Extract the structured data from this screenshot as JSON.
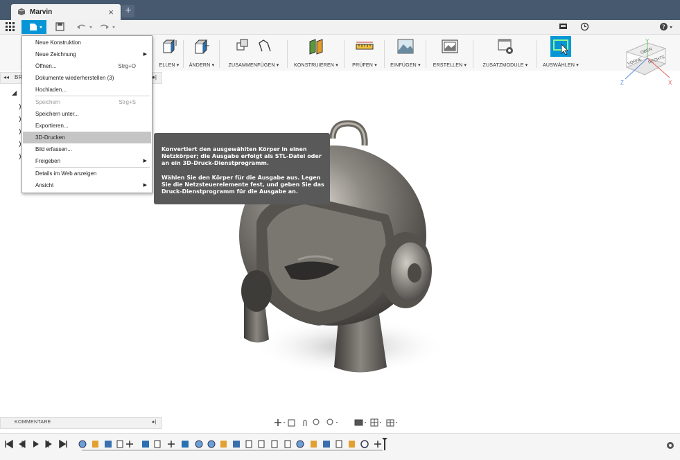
{
  "window": {
    "tab_title": "Marvin",
    "tab_close": "×",
    "new_tab": "+"
  },
  "ribbon": {
    "groups": [
      {
        "label": "ELLEN ▾"
      },
      {
        "label": "ÄNDERN ▾"
      },
      {
        "label": "ZUSAMMENFÜGEN ▾"
      },
      {
        "label": "KONSTRUIEREN ▾"
      },
      {
        "label": "PRÜFEN ▾"
      },
      {
        "label": "EINFÜGEN ▾"
      },
      {
        "label": "ERSTELLEN ▾"
      },
      {
        "label": "ZUSATZMODULE ▾"
      },
      {
        "label": "AUSWÄHLEN ▾"
      }
    ]
  },
  "browser": {
    "header": "BR"
  },
  "viewcube": {
    "top": "OBEN",
    "front": "VORNE",
    "right": "RECHTS",
    "axis_x": "X",
    "axis_y": "Y",
    "axis_z": "Z"
  },
  "file_menu": {
    "items": [
      {
        "label": "Neue Konstruktion",
        "shortcut": "",
        "submenu": false
      },
      {
        "label": "Neue Zeichnung",
        "shortcut": "",
        "submenu": true
      },
      {
        "label": "Öffnen...",
        "shortcut": "Strg+O",
        "submenu": false
      },
      {
        "label": "Dokumente wiederherstellen (3)",
        "shortcut": "",
        "submenu": false
      },
      {
        "label": "Hochladen...",
        "shortcut": "",
        "submenu": false
      },
      {
        "label": "Speichern",
        "shortcut": "Strg+S",
        "submenu": false,
        "disabled": true
      },
      {
        "label": "Speichern unter...",
        "shortcut": "",
        "submenu": false
      },
      {
        "label": "Exportieren...",
        "shortcut": "",
        "submenu": false
      },
      {
        "label": "3D-Drucken",
        "shortcut": "",
        "submenu": false,
        "highlighted": true
      },
      {
        "label": "Bild erfassen...",
        "shortcut": "",
        "submenu": false
      },
      {
        "label": "Freigeben",
        "shortcut": "",
        "submenu": true
      },
      {
        "label": "Details im Web anzeigen",
        "shortcut": "",
        "submenu": false
      },
      {
        "label": "Ansicht",
        "shortcut": "",
        "submenu": true
      }
    ]
  },
  "tooltip": {
    "line1": "Konvertiert den ausgewählten Körper in einen",
    "line2": "Netzkörper; die Ausgabe erfolgt als STL-Datei oder",
    "line3": "an ein 3D-Druck-Dienstprogramm.",
    "line4": "Wählen Sie den Körper für die Ausgabe aus. Legen",
    "line5": "Sie die Netzsteuerelemente fest, und geben Sie das",
    "line6": "Druck-Dienstprogramm für die Ausgabe an."
  },
  "comments": {
    "label": "KOMMENTARE"
  },
  "colors": {
    "accent": "#0696d7",
    "titlebar": "#47596f",
    "tooltip_bg": "#595959",
    "menu_highlight": "#c5c5c5"
  }
}
